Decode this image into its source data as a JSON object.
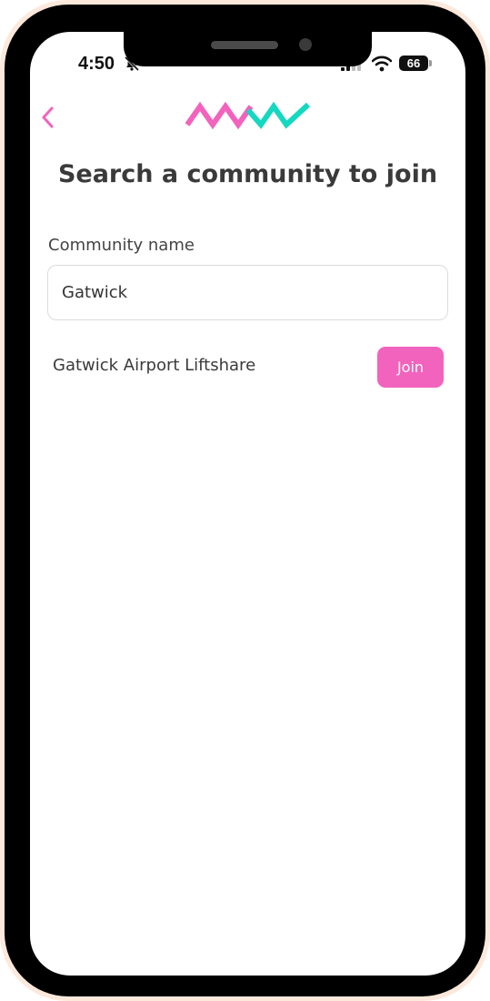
{
  "status_bar": {
    "time": "4:50",
    "battery": "66"
  },
  "icons": {
    "back": "chevron-left-icon",
    "logo": "zigzag-logo-icon",
    "silent": "bell-slash-icon",
    "signal": "cellular-signal-icon",
    "wifi": "wifi-icon"
  },
  "colors": {
    "accent_pink": "#f163bd",
    "accent_teal": "#14d8c0"
  },
  "page": {
    "title": "Search a community to join"
  },
  "search": {
    "label": "Community name",
    "value": "Gatwick"
  },
  "results": [
    {
      "name": "Gatwick Airport Liftshare",
      "action_label": "Join"
    }
  ]
}
